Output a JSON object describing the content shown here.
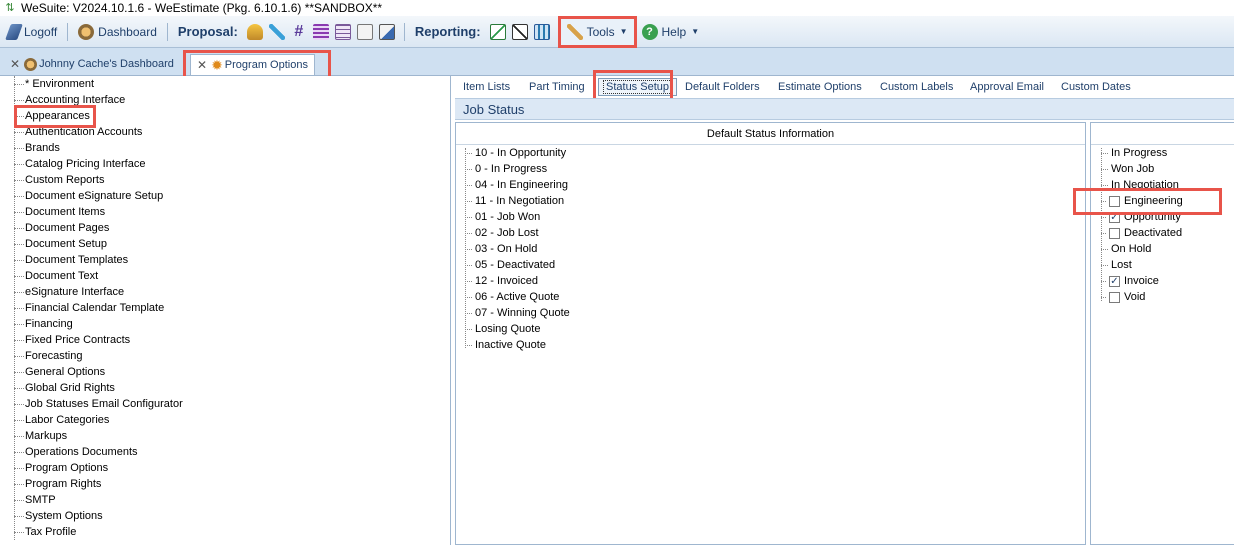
{
  "window": {
    "title": "WeSuite: V2024.10.1.6 - WeEstimate (Pkg. 6.10.1.6) **SANDBOX**"
  },
  "toolbar": {
    "logoff": "Logoff",
    "dashboard": "Dashboard",
    "proposal_label": "Proposal:",
    "reporting_label": "Reporting:",
    "tools": "Tools",
    "help": "Help"
  },
  "doc_tabs": [
    {
      "label": "Johnny Cache's Dashboard"
    },
    {
      "label": "Program Options"
    }
  ],
  "tree": {
    "items": [
      "* Environment",
      "Accounting Interface",
      "Appearances",
      "Authentication Accounts",
      "Brands",
      "Catalog Pricing Interface",
      "Custom Reports",
      "Document eSignature Setup",
      "Document Items",
      "Document Pages",
      "Document Setup",
      "Document Templates",
      "Document Text",
      "eSignature Interface",
      "Financial Calendar Template",
      "Financing",
      "Fixed Price Contracts",
      "Forecasting",
      "General Options",
      "Global Grid Rights",
      "Job Statuses Email Configurator",
      "Labor Categories",
      "Markups",
      "Operations Documents",
      "Program Options",
      "Program Rights",
      "SMTP",
      "System Options",
      "Tax Profile"
    ]
  },
  "settings_tabs": [
    "Item Lists",
    "Part Timing",
    "Status Setup",
    "Default Folders",
    "Estimate Options",
    "Custom Labels",
    "Approval Email",
    "Custom Dates"
  ],
  "section_title": "Job Status",
  "default_panel": {
    "header": "Default Status Information",
    "items": [
      "10 - In Opportunity",
      "0 - In Progress",
      "04 - In Engineering",
      "11 - In Negotiation",
      "01 - Job Won",
      "02 - Job Lost",
      "03 - On Hold",
      "05 - Deactivated",
      "12 - Invoiced",
      "06 - Active Quote",
      "07 - Winning Quote",
      "Losing Quote",
      "Inactive Quote"
    ]
  },
  "right_panel": {
    "items": [
      {
        "label": "In Progress",
        "checkbox": false
      },
      {
        "label": "Won Job",
        "checkbox": false
      },
      {
        "label": "In Negotiation",
        "checkbox": false
      },
      {
        "label": "Engineering",
        "checkbox": true,
        "checked": false
      },
      {
        "label": "Opportunity",
        "checkbox": true,
        "checked": true
      },
      {
        "label": "Deactivated",
        "checkbox": true,
        "checked": false
      },
      {
        "label": "On Hold",
        "checkbox": false
      },
      {
        "label": "Lost",
        "checkbox": false
      },
      {
        "label": "Invoice",
        "checkbox": true,
        "checked": true
      },
      {
        "label": "Void",
        "checkbox": true,
        "checked": false
      }
    ]
  },
  "colors": {
    "highlight": "#e8544a",
    "toolbar_text": "#1f3f6a"
  }
}
